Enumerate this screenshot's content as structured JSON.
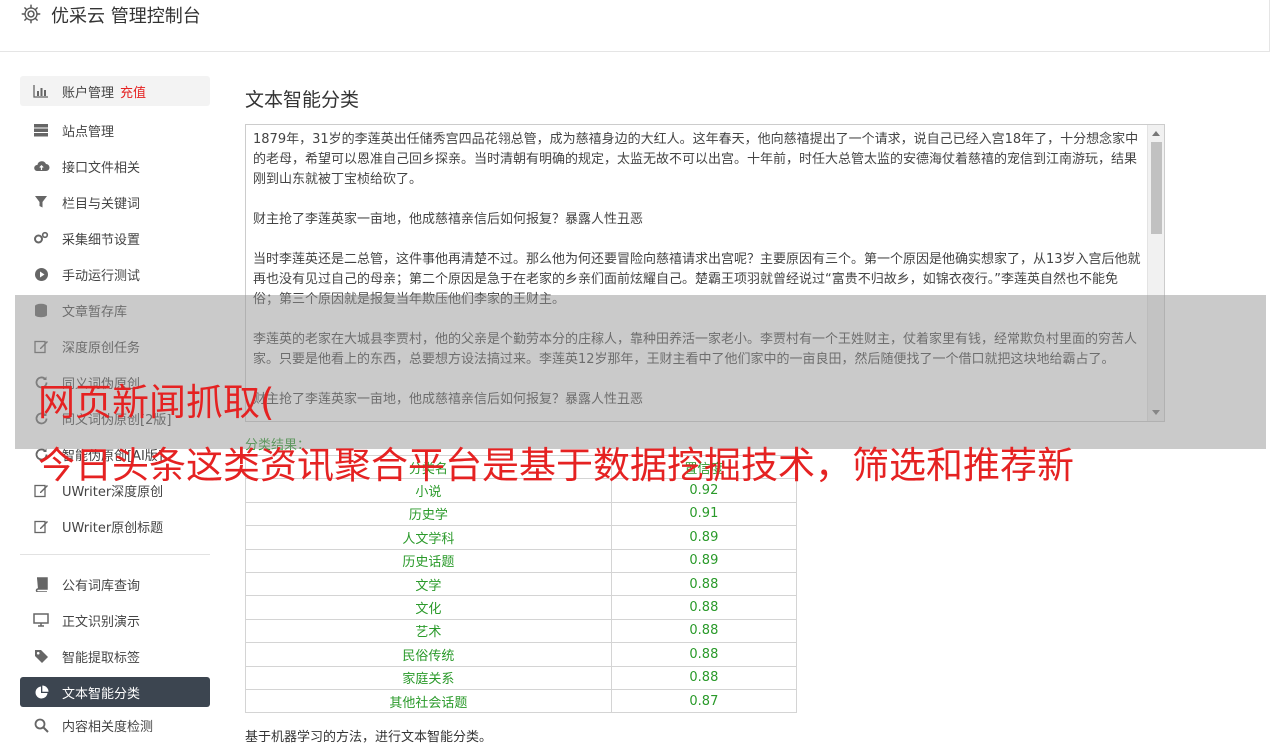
{
  "header": {
    "title": "优采云 管理控制台",
    "icon": "gear-icon"
  },
  "sidebar": {
    "groups": [
      [
        {
          "label": "账户管理",
          "badge": "充值",
          "icon": "bar-chart-icon"
        },
        {
          "label": "站点管理",
          "icon": "server-icon"
        },
        {
          "label": "接口文件相关",
          "icon": "cloud-upload-icon"
        },
        {
          "label": "栏目与关键词",
          "icon": "filter-icon"
        },
        {
          "label": "采集细节设置",
          "icon": "gears-icon"
        },
        {
          "label": "手动运行测试",
          "icon": "play-circle-icon"
        },
        {
          "label": "文章暂存库",
          "icon": "database-icon"
        },
        {
          "label": "深度原创任务",
          "icon": "edit-icon"
        },
        {
          "label": "同义词伪原创",
          "icon": "refresh-icon"
        },
        {
          "label": "同义词伪原创[2版]",
          "icon": "refresh-icon"
        },
        {
          "label": "智能伪原创[AI版]",
          "icon": "refresh-icon"
        },
        {
          "label": "UWriter深度原创",
          "icon": "edit-icon"
        },
        {
          "label": "UWriter原创标题",
          "icon": "edit-icon"
        }
      ],
      [
        {
          "label": "公有词库查询",
          "icon": "book-icon"
        },
        {
          "label": "正文识别演示",
          "icon": "monitor-icon"
        },
        {
          "label": "智能提取标签",
          "icon": "tag-icon"
        },
        {
          "label": "文本智能分类",
          "icon": "pie-chart-icon"
        },
        {
          "label": "内容相关度检测",
          "icon": "search-icon"
        }
      ]
    ]
  },
  "main": {
    "title": "文本智能分类",
    "text_paragraphs": [
      "1879年，31岁的李莲英出任储秀宫四品花翎总管，成为慈禧身边的大红人。这年春天，他向慈禧提出了一个请求，说自己已经入宫18年了，十分想念家中的老母，希望可以恩准自己回乡探亲。当时清朝有明确的规定，太监无故不可以出宫。十年前，时任大总管太监的安德海仗着慈禧的宠信到江南游玩，结果刚到山东就被丁宝桢给砍了。",
      "财主抢了李莲英家一亩地，他成慈禧亲信后如何报复？暴露人性丑恶",
      "当时李莲英还是二总管，这件事他再清楚不过。那么他为何还要冒险向慈禧请求出宫呢？主要原因有三个。第一个原因是他确实想家了，从13岁入宫后他就再也没有见过自己的母亲；第二个原因是急于在老家的乡亲们面前炫耀自己。楚霸王项羽就曾经说过“富贵不归故乡，如锦衣夜行。”李莲英自然也不能免俗；第三个原因就是报复当年欺压他们李家的王财主。",
      "李莲英的老家在大城县李贾村，他的父亲是个勤劳本分的庄稼人，靠种田养活一家老小。李贾村有一个王姓财主，仗着家里有钱，经常欺负村里面的穷苦人家。只要是他看上的东西，总要想方设法搞过来。李莲英12岁那年，王财主看中了他们家中的一亩良田，然后随便找了一个借口就把这块地给霸占了。",
      "财主抢了李莲英家一亩地，他成慈禧亲信后如何报复？暴露人性丑恶"
    ],
    "result_label": "分类结果：",
    "table_headers": [
      "分类名",
      "置信度"
    ],
    "table_rows": [
      [
        "小说",
        "0.92"
      ],
      [
        "历史学",
        "0.91"
      ],
      [
        "人文学科",
        "0.89"
      ],
      [
        "历史话题",
        "0.89"
      ],
      [
        "文学",
        "0.88"
      ],
      [
        "文化",
        "0.88"
      ],
      [
        "艺术",
        "0.88"
      ],
      [
        "民俗传统",
        "0.88"
      ],
      [
        "家庭关系",
        "0.88"
      ],
      [
        "其他社会话题",
        "0.87"
      ]
    ],
    "footnote": "基于机器学习的方法，进行文本智能分类。"
  },
  "overlay": {
    "title": "网页新闻抓取(",
    "subtitle": "今日头条这类资讯聚合平台是基于数据挖掘技术，筛选和推荐新"
  },
  "colors": {
    "accent_red": "#e52222",
    "result_green": "#2a9a2a",
    "active_nav_bg": "#3c4550"
  }
}
